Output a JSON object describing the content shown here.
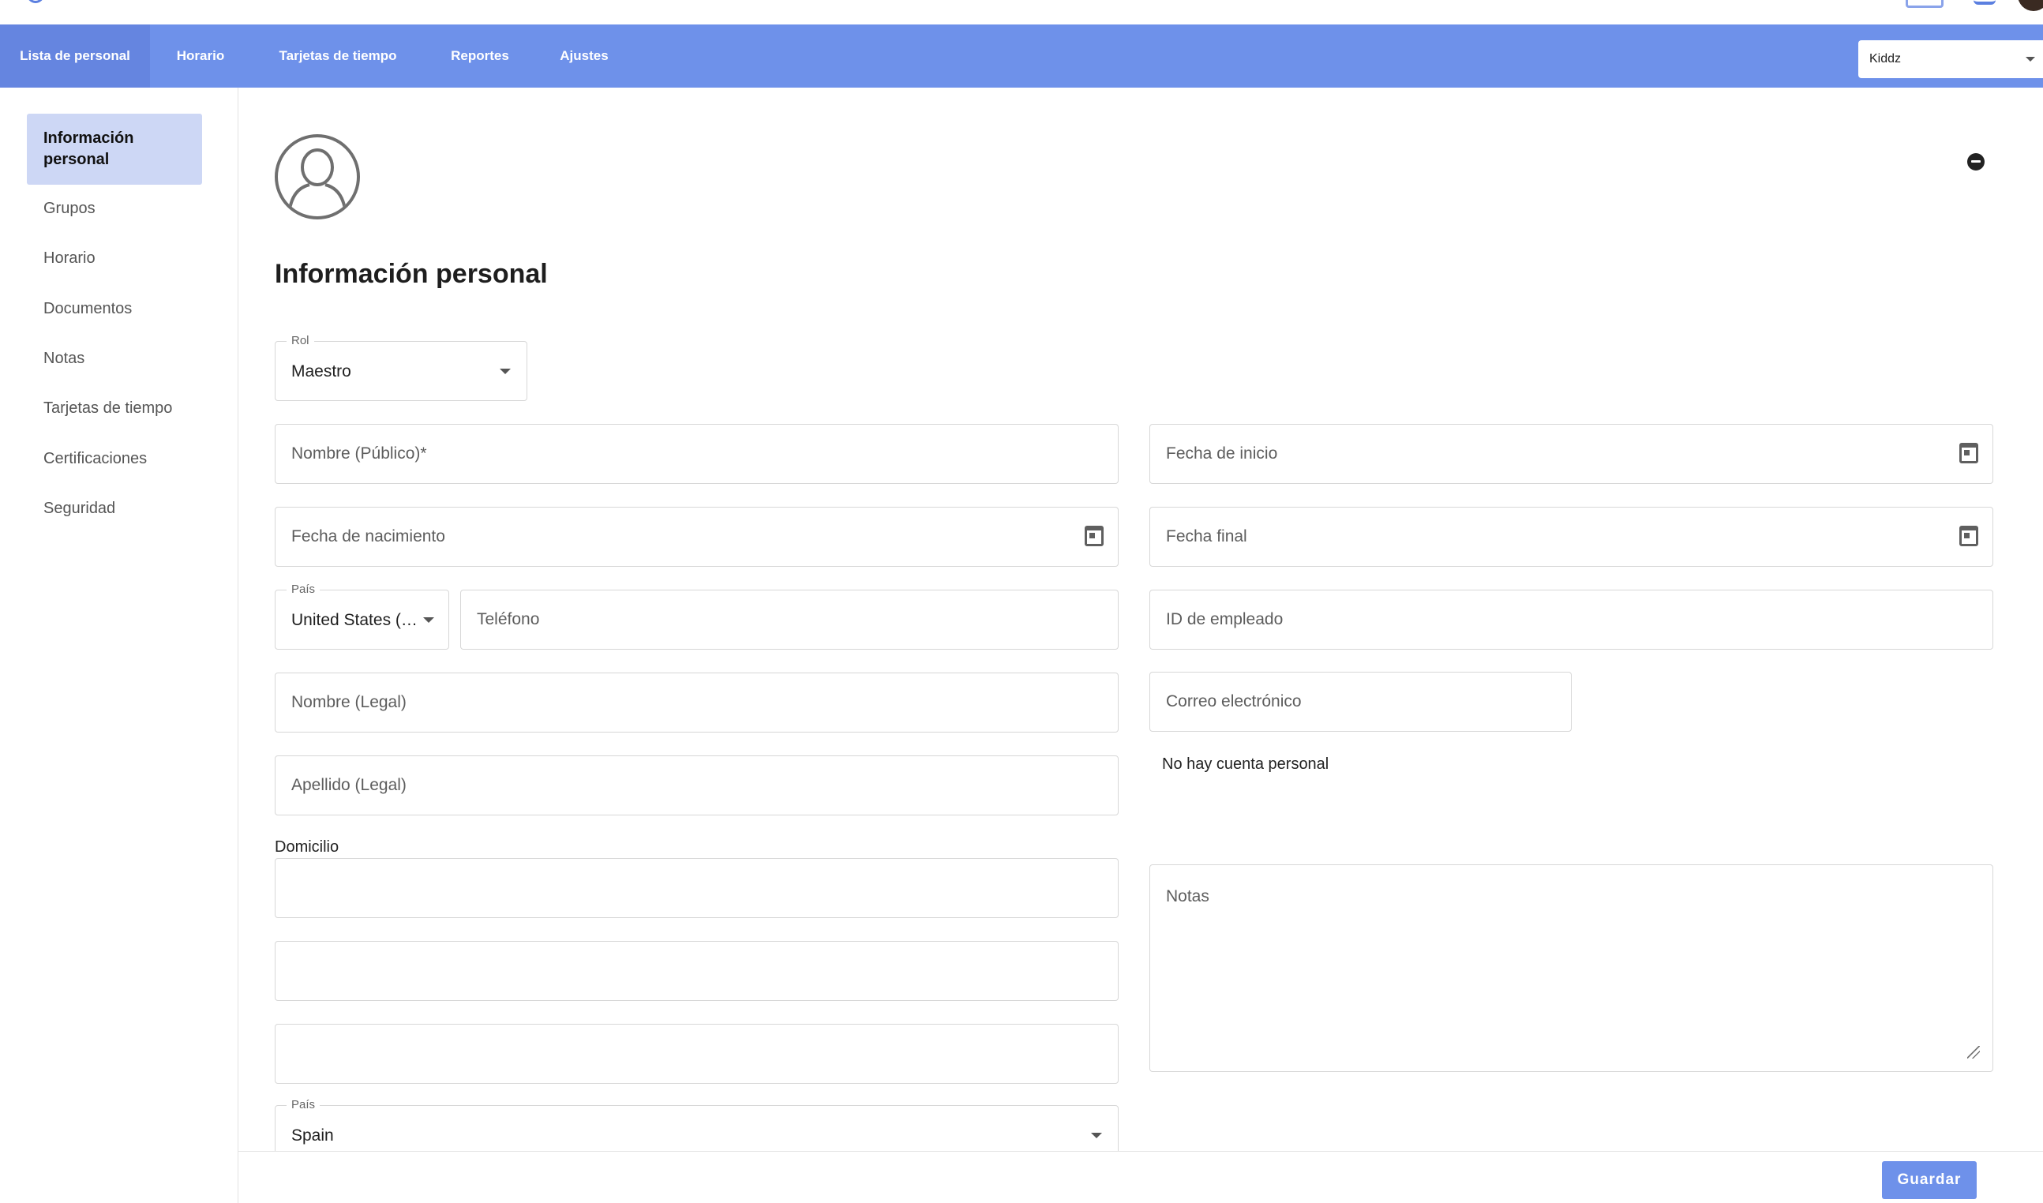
{
  "nav": {
    "tabs": [
      "Lista de personal",
      "Horario",
      "Tarjetas de tiempo",
      "Reportes",
      "Ajustes"
    ],
    "org_select": "Kiddz"
  },
  "sidebar": {
    "items": [
      "Información personal",
      "Grupos",
      "Horario",
      "Documentos",
      "Notas",
      "Tarjetas de tiempo",
      "Certificaciones",
      "Seguridad"
    ]
  },
  "form": {
    "title": "Información personal",
    "rol_label": "Rol",
    "rol_value": "Maestro",
    "nombre_publico": "Nombre (Público)*",
    "fecha_inicio": "Fecha de inicio",
    "fecha_nacimiento": "Fecha de nacimiento",
    "fecha_final": "Fecha final",
    "pais_label": "País",
    "pais_phone_value": "United States (…",
    "telefono": "Teléfono",
    "id_empleado": "ID de empleado",
    "nombre_legal": "Nombre (Legal)",
    "correo": "Correo electrónico",
    "no_cuenta": "No hay cuenta personal",
    "apellido_legal": "Apellido (Legal)",
    "domicilio_label": "Domicilio",
    "notas": "Notas",
    "pais_addr_value": "Spain"
  },
  "footer": {
    "save_label": "Guardar"
  },
  "colors": {
    "nav_bg": "#6e91ea",
    "active_side_bg": "#cdd7f5",
    "save_bg": "#6e91ea"
  }
}
